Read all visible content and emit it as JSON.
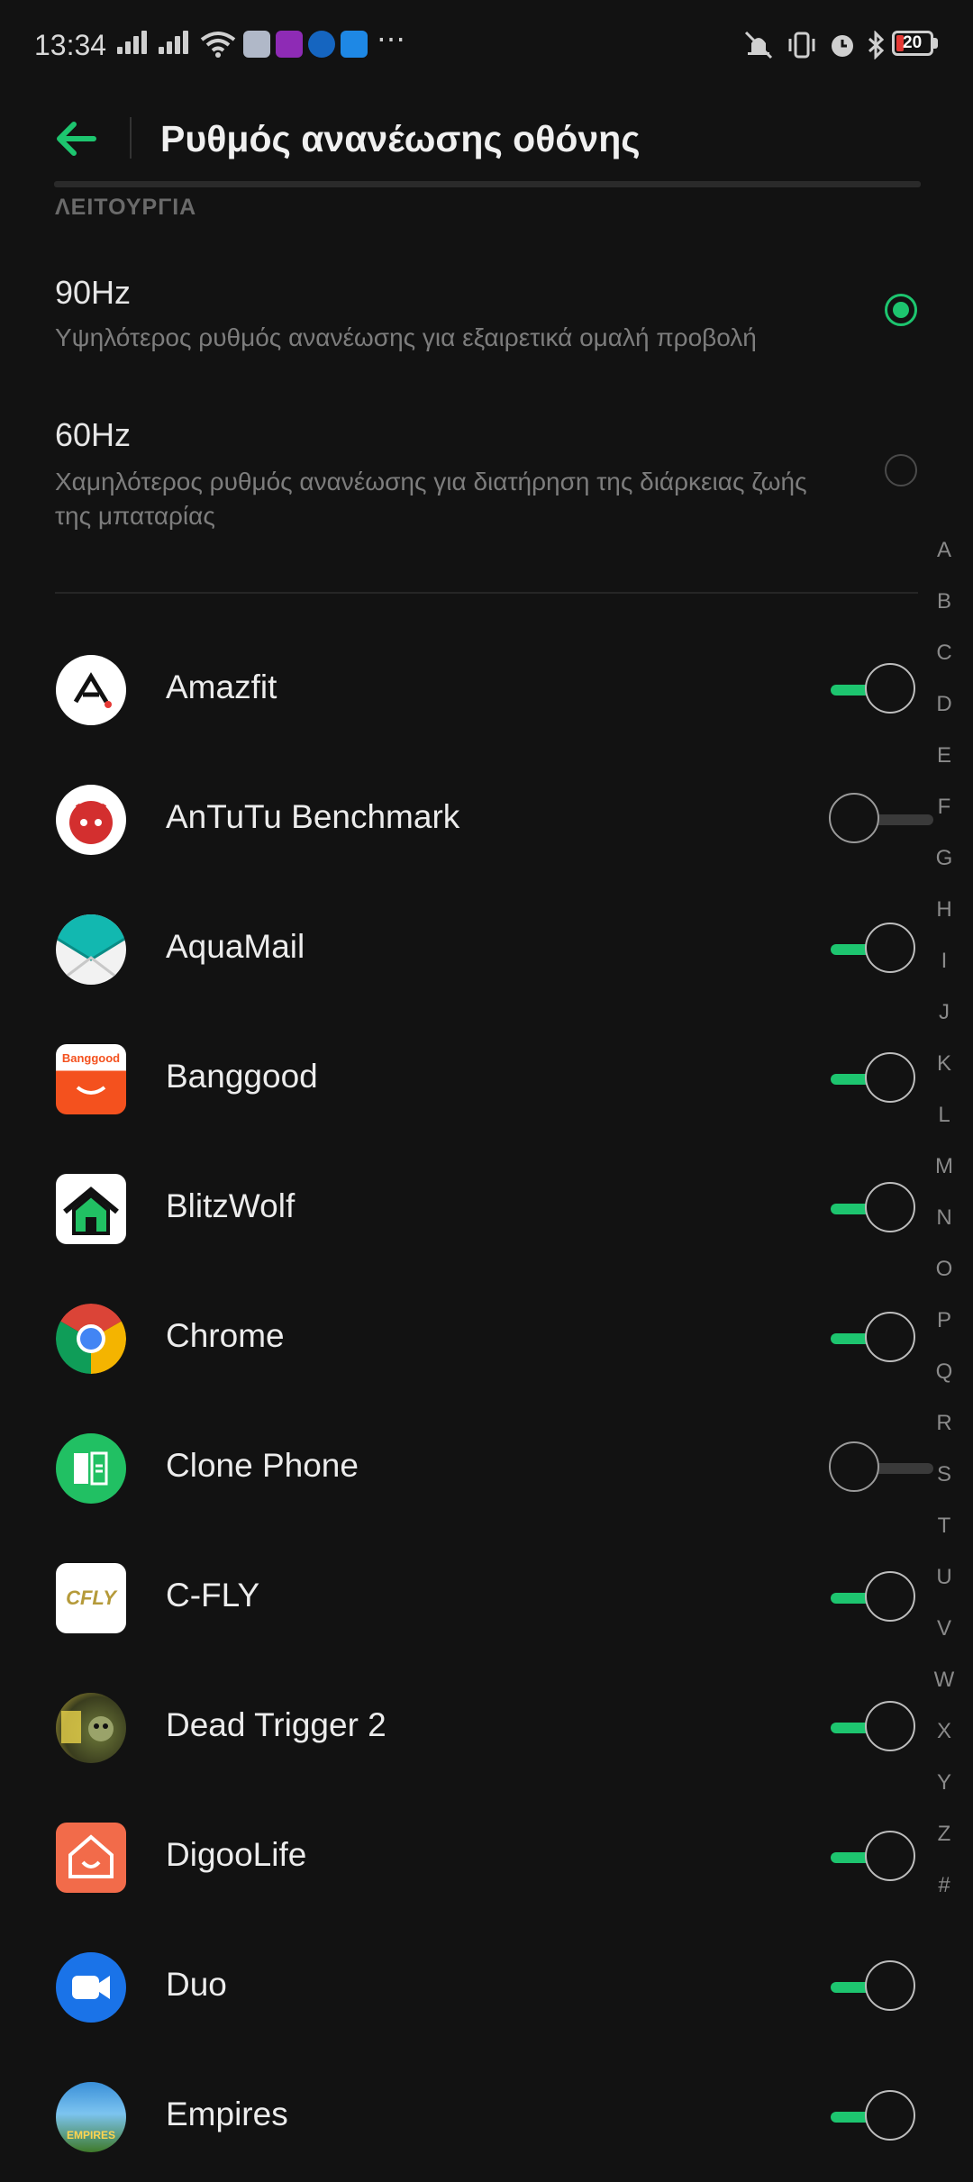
{
  "status_bar": {
    "time": "13:34",
    "battery_level": "20",
    "icons": [
      "signal-icon",
      "signal-icon",
      "wifi-icon",
      "stack-app-icon",
      "gallery-app-icon",
      "paypal-icon",
      "bluetooth-app-icon",
      "more-dots-icon",
      "mute-icon",
      "vibrate-icon",
      "alarm-icon",
      "bluetooth-icon",
      "battery-icon"
    ],
    "more": "⋯"
  },
  "toolbar": {
    "title": "Ρυθμός ανανέωσης οθόνης"
  },
  "section": {
    "label": "ΛΕΙΤΟΥΡΓΙΑ"
  },
  "modes": [
    {
      "title": "90Hz",
      "description": "Υψηλότερος ρυθμός ανανέωσης για εξαιρετικά ομαλή προβολή",
      "selected": true
    },
    {
      "title": "60Hz",
      "description": "Χαμηλότερος ρυθμός ανανέωσης για διατήρηση της διάρκειας ζωής της μπαταρίας",
      "selected": false
    }
  ],
  "apps": [
    {
      "name": "Amazfit",
      "enabled": true
    },
    {
      "name": "AnTuTu Benchmark",
      "enabled": false
    },
    {
      "name": "AquaMail",
      "enabled": true
    },
    {
      "name": "Banggood",
      "enabled": true
    },
    {
      "name": "BlitzWolf",
      "enabled": true
    },
    {
      "name": "Chrome",
      "enabled": true
    },
    {
      "name": "Clone Phone",
      "enabled": false
    },
    {
      "name": "C-FLY",
      "enabled": true
    },
    {
      "name": "Dead Trigger 2",
      "enabled": true
    },
    {
      "name": "DigooLife",
      "enabled": true
    },
    {
      "name": "Duo",
      "enabled": true
    },
    {
      "name": "Empires",
      "enabled": true
    }
  ],
  "alpha_index": [
    "A",
    "B",
    "C",
    "D",
    "E",
    "F",
    "G",
    "H",
    "I",
    "J",
    "K",
    "L",
    "M",
    "N",
    "O",
    "P",
    "Q",
    "R",
    "S",
    "T",
    "U",
    "V",
    "W",
    "X",
    "Y",
    "Z",
    "#"
  ],
  "icon_text": {
    "banggood": "Banggood",
    "cfly": "CFLY",
    "empires": "EMPIRES"
  },
  "colors": {
    "accent": "#1dc56f",
    "background": "#121212"
  }
}
